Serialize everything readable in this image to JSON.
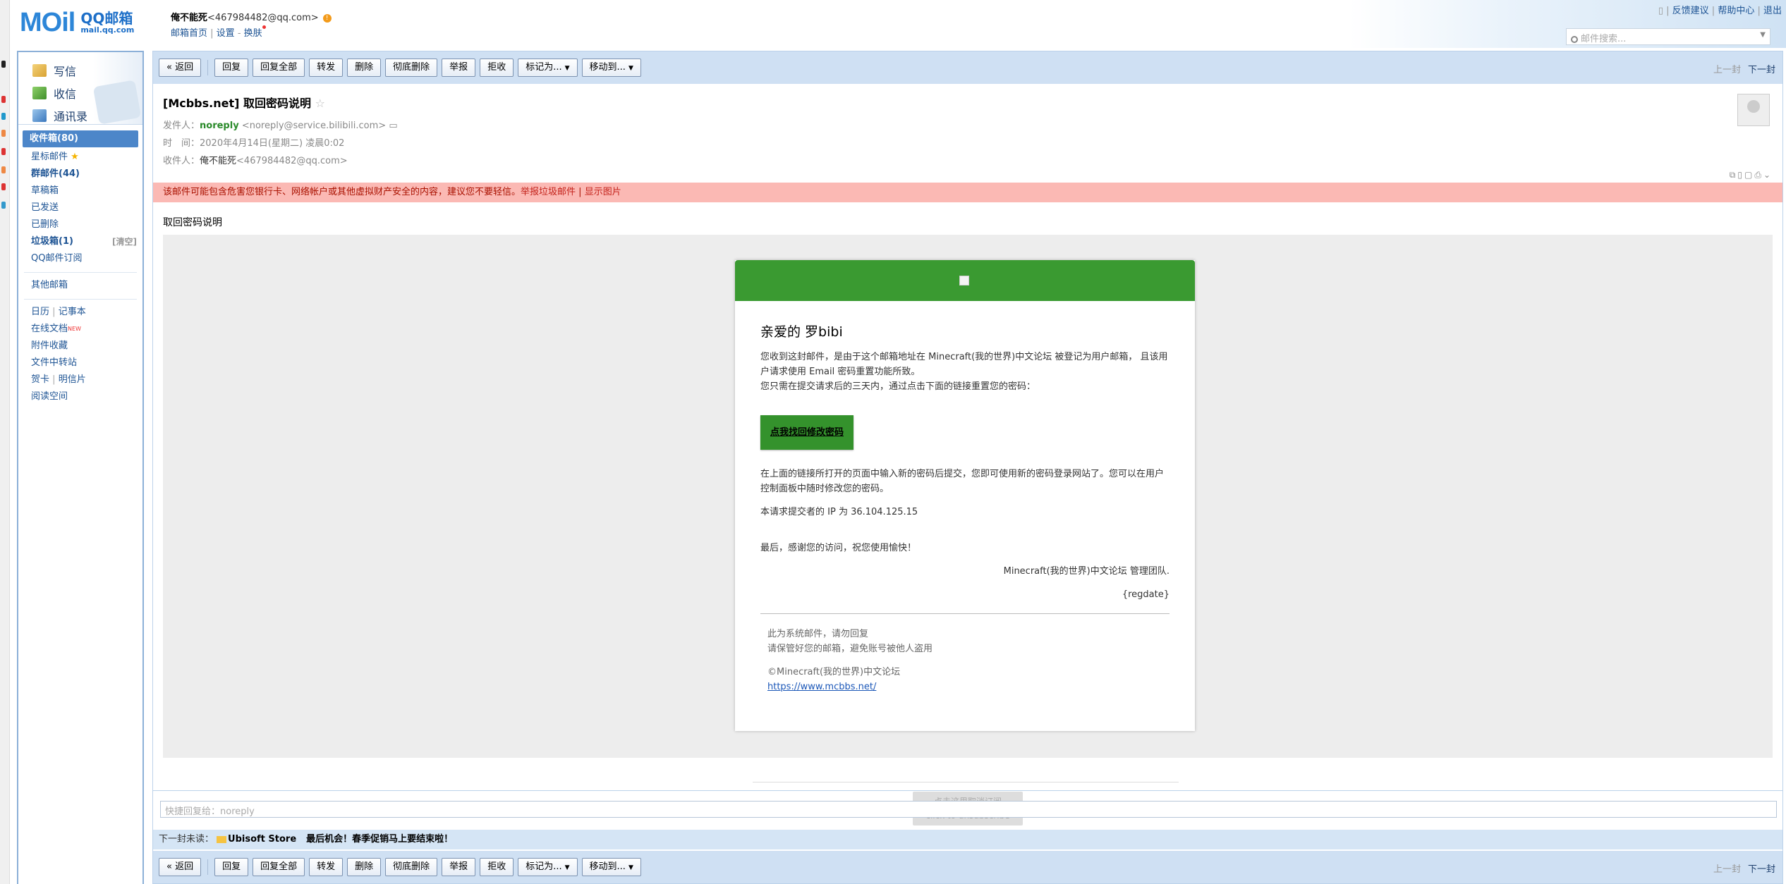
{
  "header": {
    "logo_main": "MOil",
    "logo_title": "QQ邮箱",
    "logo_domain": "mail.qq.com",
    "user_name": "俺不能死",
    "user_email": "<467984482@qq.com>",
    "link_home": "邮箱首页",
    "link_settings": "设置",
    "link_skin": "换肤",
    "top_links": [
      "反馈建议",
      "帮助中心",
      "退出"
    ],
    "search_placeholder": "邮件搜索..."
  },
  "sidebar": {
    "compose": "写信",
    "inbox": "收信",
    "contacts": "通讯录",
    "folders": [
      {
        "label": "收件箱(80)",
        "bold": true,
        "selected": true
      },
      {
        "label": "星标邮件",
        "star": true
      },
      {
        "label": "群邮件(44)",
        "bold": true
      },
      {
        "label": "草稿箱"
      },
      {
        "label": "已发送"
      },
      {
        "label": "已删除"
      },
      {
        "label": "垃圾箱(1)",
        "bold": true,
        "extra": "[清空]"
      },
      {
        "label": "QQ邮件订阅"
      }
    ],
    "other_mailbox": "其他邮箱",
    "tools": [
      {
        "label": "日历",
        "second": "记事本"
      },
      {
        "label": "在线文档",
        "badge": "NEW"
      },
      {
        "label": "附件收藏"
      },
      {
        "label": "文件中转站"
      },
      {
        "label": "贺卡",
        "second": "明信片"
      },
      {
        "label": "阅读空间"
      }
    ]
  },
  "toolbar": {
    "back": "« 返回",
    "reply": "回复",
    "reply_all": "回复全部",
    "forward": "转发",
    "delete": "删除",
    "delete_perm": "彻底删除",
    "report": "举报",
    "reject": "拒收",
    "mark_as": "标记为...",
    "move_to": "移动到...",
    "prev": "上一封",
    "next": "下一封"
  },
  "message": {
    "subject": "[Mcbbs.net] 取回密码说明",
    "from_label": "发件人：",
    "from_name": "noreply",
    "from_addr": "<noreply@service.bilibili.com>",
    "time_label": "时　间：",
    "time_value": "2020年4月14日(星期二) 凌晨0:02",
    "to_label": "收件人：",
    "to_name": "俺不能死",
    "to_addr": "<467984482@qq.com>",
    "warning": "该邮件可能包含危害您银行卡、网络帐户或其他虚拟财产安全的内容，建议您不要轻信。",
    "warning_link1": "举报垃圾邮件",
    "warning_link2": "显示图片",
    "body_title": "取回密码说明"
  },
  "email": {
    "greeting": "亲爱的 罗bibi",
    "p1": "您收到这封邮件，是由于这个邮箱地址在 Minecraft(我的世界)中文论坛 被登记为用户邮箱， 且该用户请求使用 Email 密码重置功能所致。",
    "p2": "您只需在提交请求后的三天内，通过点击下面的链接重置您的密码：",
    "button": "点我找回修改密码",
    "p3": "在上面的链接所打开的页面中输入新的密码后提交，您即可使用新的密码登录网站了。您可以在用户控制面板中随时修改您的密码。",
    "p4": "本请求提交者的 IP 为 36.104.125.15",
    "p5": "最后，感谢您的访问，祝您使用愉快！",
    "sign": "Minecraft(我的世界)中文论坛 管理团队.",
    "regdate": "{regdate}",
    "foot1": "此为系统邮件，请勿回复",
    "foot2": "请保管好您的邮箱，避免账号被他人盗用",
    "copyright": "©Minecraft(我的世界)中文论坛",
    "url": "https://www.mcbbs.net/"
  },
  "unsubscribe": {
    "line1": "点击这里取消订阅",
    "line2": "click to unsubscribe"
  },
  "reply_placeholder": "快捷回复给：noreply",
  "next_mail": {
    "label": "下一封未读：",
    "sender": "Ubisoft Store",
    "subject": "最后机会！春季促销马上要结束啦！"
  },
  "colors": {
    "accent": "#4c86c9",
    "email_header": "#3a9a31",
    "warning_bg": "#fbb9b4"
  }
}
